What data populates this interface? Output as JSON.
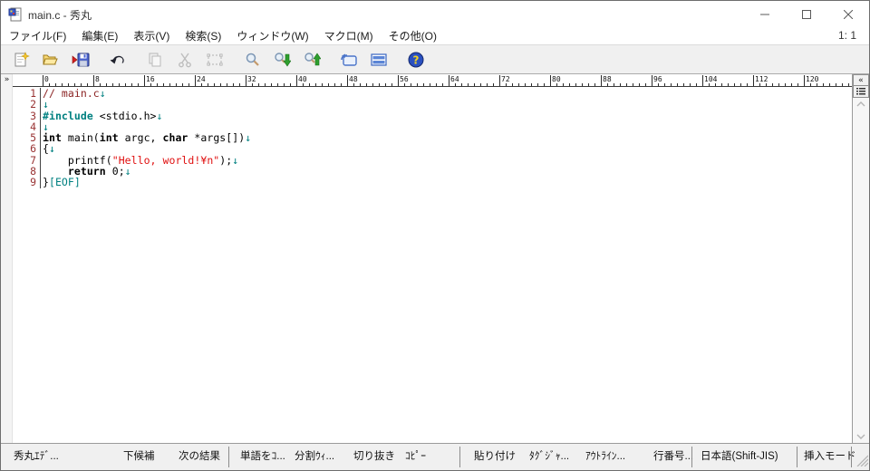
{
  "window": {
    "title": "main.c - 秀丸",
    "caption_buttons": [
      "minimize",
      "maximize",
      "close"
    ]
  },
  "menu": {
    "items": [
      {
        "id": "file",
        "label": "ファイル(F)"
      },
      {
        "id": "edit",
        "label": "編集(E)"
      },
      {
        "id": "view",
        "label": "表示(V)"
      },
      {
        "id": "search",
        "label": "検索(S)"
      },
      {
        "id": "window",
        "label": "ウィンドウ(W)"
      },
      {
        "id": "macro",
        "label": "マクロ(M)"
      },
      {
        "id": "other",
        "label": "その他(O)"
      }
    ],
    "cursor_position": "1: 1"
  },
  "toolbar": {
    "buttons": [
      {
        "id": "new-file",
        "disabled": false,
        "group_start": false
      },
      {
        "id": "open-folder",
        "disabled": false,
        "group_start": false
      },
      {
        "id": "save",
        "disabled": false,
        "group_start": false
      },
      {
        "id": "undo",
        "disabled": false,
        "group_start": true
      },
      {
        "id": "copy",
        "disabled": true,
        "group_start": true
      },
      {
        "id": "cut",
        "disabled": true,
        "group_start": false
      },
      {
        "id": "select",
        "disabled": true,
        "group_start": false
      },
      {
        "id": "search",
        "disabled": false,
        "group_start": true
      },
      {
        "id": "search-next",
        "disabled": false,
        "group_start": false
      },
      {
        "id": "search-prev",
        "disabled": false,
        "group_start": false
      },
      {
        "id": "tag-jump",
        "disabled": false,
        "group_start": true
      },
      {
        "id": "split-window",
        "disabled": false,
        "group_start": false
      },
      {
        "id": "help",
        "disabled": false,
        "group_start": true
      }
    ]
  },
  "editor": {
    "ruler_labels": [
      0,
      8,
      16,
      24,
      32,
      40,
      48,
      56,
      64,
      72,
      80,
      88,
      96,
      104,
      112,
      120
    ],
    "left_margin_button": "»",
    "corner_buttons": [
      {
        "id": "collapse-ruler",
        "glyph": "«"
      },
      {
        "id": "line-list",
        "glyph": "list-icon"
      }
    ],
    "lines": [
      {
        "num": "1",
        "segments": [
          {
            "t": "// main.c",
            "s": "comment"
          },
          {
            "t": "↓",
            "s": "mark"
          }
        ]
      },
      {
        "num": "2",
        "segments": [
          {
            "t": "↓",
            "s": "mark"
          }
        ]
      },
      {
        "num": "3",
        "segments": [
          {
            "t": "#include",
            "s": "preproc"
          },
          {
            "t": " <stdio.h>",
            "s": "plain"
          },
          {
            "t": "↓",
            "s": "mark"
          }
        ]
      },
      {
        "num": "4",
        "segments": [
          {
            "t": "↓",
            "s": "mark"
          }
        ]
      },
      {
        "num": "5",
        "segments": [
          {
            "t": "int",
            "s": "bold"
          },
          {
            "t": " main(",
            "s": "plain"
          },
          {
            "t": "int",
            "s": "bold"
          },
          {
            "t": " argc, ",
            "s": "plain"
          },
          {
            "t": "char",
            "s": "bold"
          },
          {
            "t": " *args[])",
            "s": "plain"
          },
          {
            "t": "↓",
            "s": "mark"
          }
        ]
      },
      {
        "num": "6",
        "segments": [
          {
            "t": "{",
            "s": "plain"
          },
          {
            "t": "↓",
            "s": "mark"
          }
        ]
      },
      {
        "num": "7",
        "segments": [
          {
            "t": "    printf(",
            "s": "plain"
          },
          {
            "t": "\"Hello, world!¥n\"",
            "s": "string"
          },
          {
            "t": ");",
            "s": "plain"
          },
          {
            "t": "↓",
            "s": "mark"
          }
        ]
      },
      {
        "num": "8",
        "segments": [
          {
            "t": "    ",
            "s": "plain"
          },
          {
            "t": "return",
            "s": "bold"
          },
          {
            "t": " 0;",
            "s": "plain"
          },
          {
            "t": "↓",
            "s": "mark"
          }
        ]
      },
      {
        "num": "9",
        "segments": [
          {
            "t": "}",
            "s": "plain"
          },
          {
            "t": "[EOF]",
            "s": "eof"
          }
        ]
      }
    ]
  },
  "statusbar": {
    "items": [
      {
        "id": "app-name",
        "label": "秀丸ｴﾃﾞ..."
      },
      {
        "id": "next-candidate",
        "label": "下候補"
      },
      {
        "id": "next-result",
        "label": "次の結果"
      },
      {
        "id": "copy-word",
        "label": "単語をｺ..."
      },
      {
        "id": "split-window",
        "label": "分割ｳｨ..."
      },
      {
        "id": "cut",
        "label": "切り抜き"
      },
      {
        "id": "copy",
        "label": "ｺﾋﾟｰ"
      },
      {
        "id": "paste",
        "label": "貼り付け"
      },
      {
        "id": "tag-jump",
        "label": "ﾀｸﾞｼﾞｬ..."
      },
      {
        "id": "outline",
        "label": "ｱｳﾄﾗｲﾝ..."
      },
      {
        "id": "line-number",
        "label": "行番号..."
      },
      {
        "id": "encoding",
        "label": "日本語(Shift-JIS)"
      },
      {
        "id": "input-mode",
        "label": "挿入モード"
      }
    ]
  },
  "colors": {
    "comment": "#8b2323",
    "preprocessor": "#008080",
    "string": "#e01010",
    "newline_mark": "#008080",
    "eof_mark": "#008080",
    "line_number": "#993333",
    "toolbar_bg": "#f0f0f0",
    "statusbar_bg": "#f0f0f0"
  }
}
